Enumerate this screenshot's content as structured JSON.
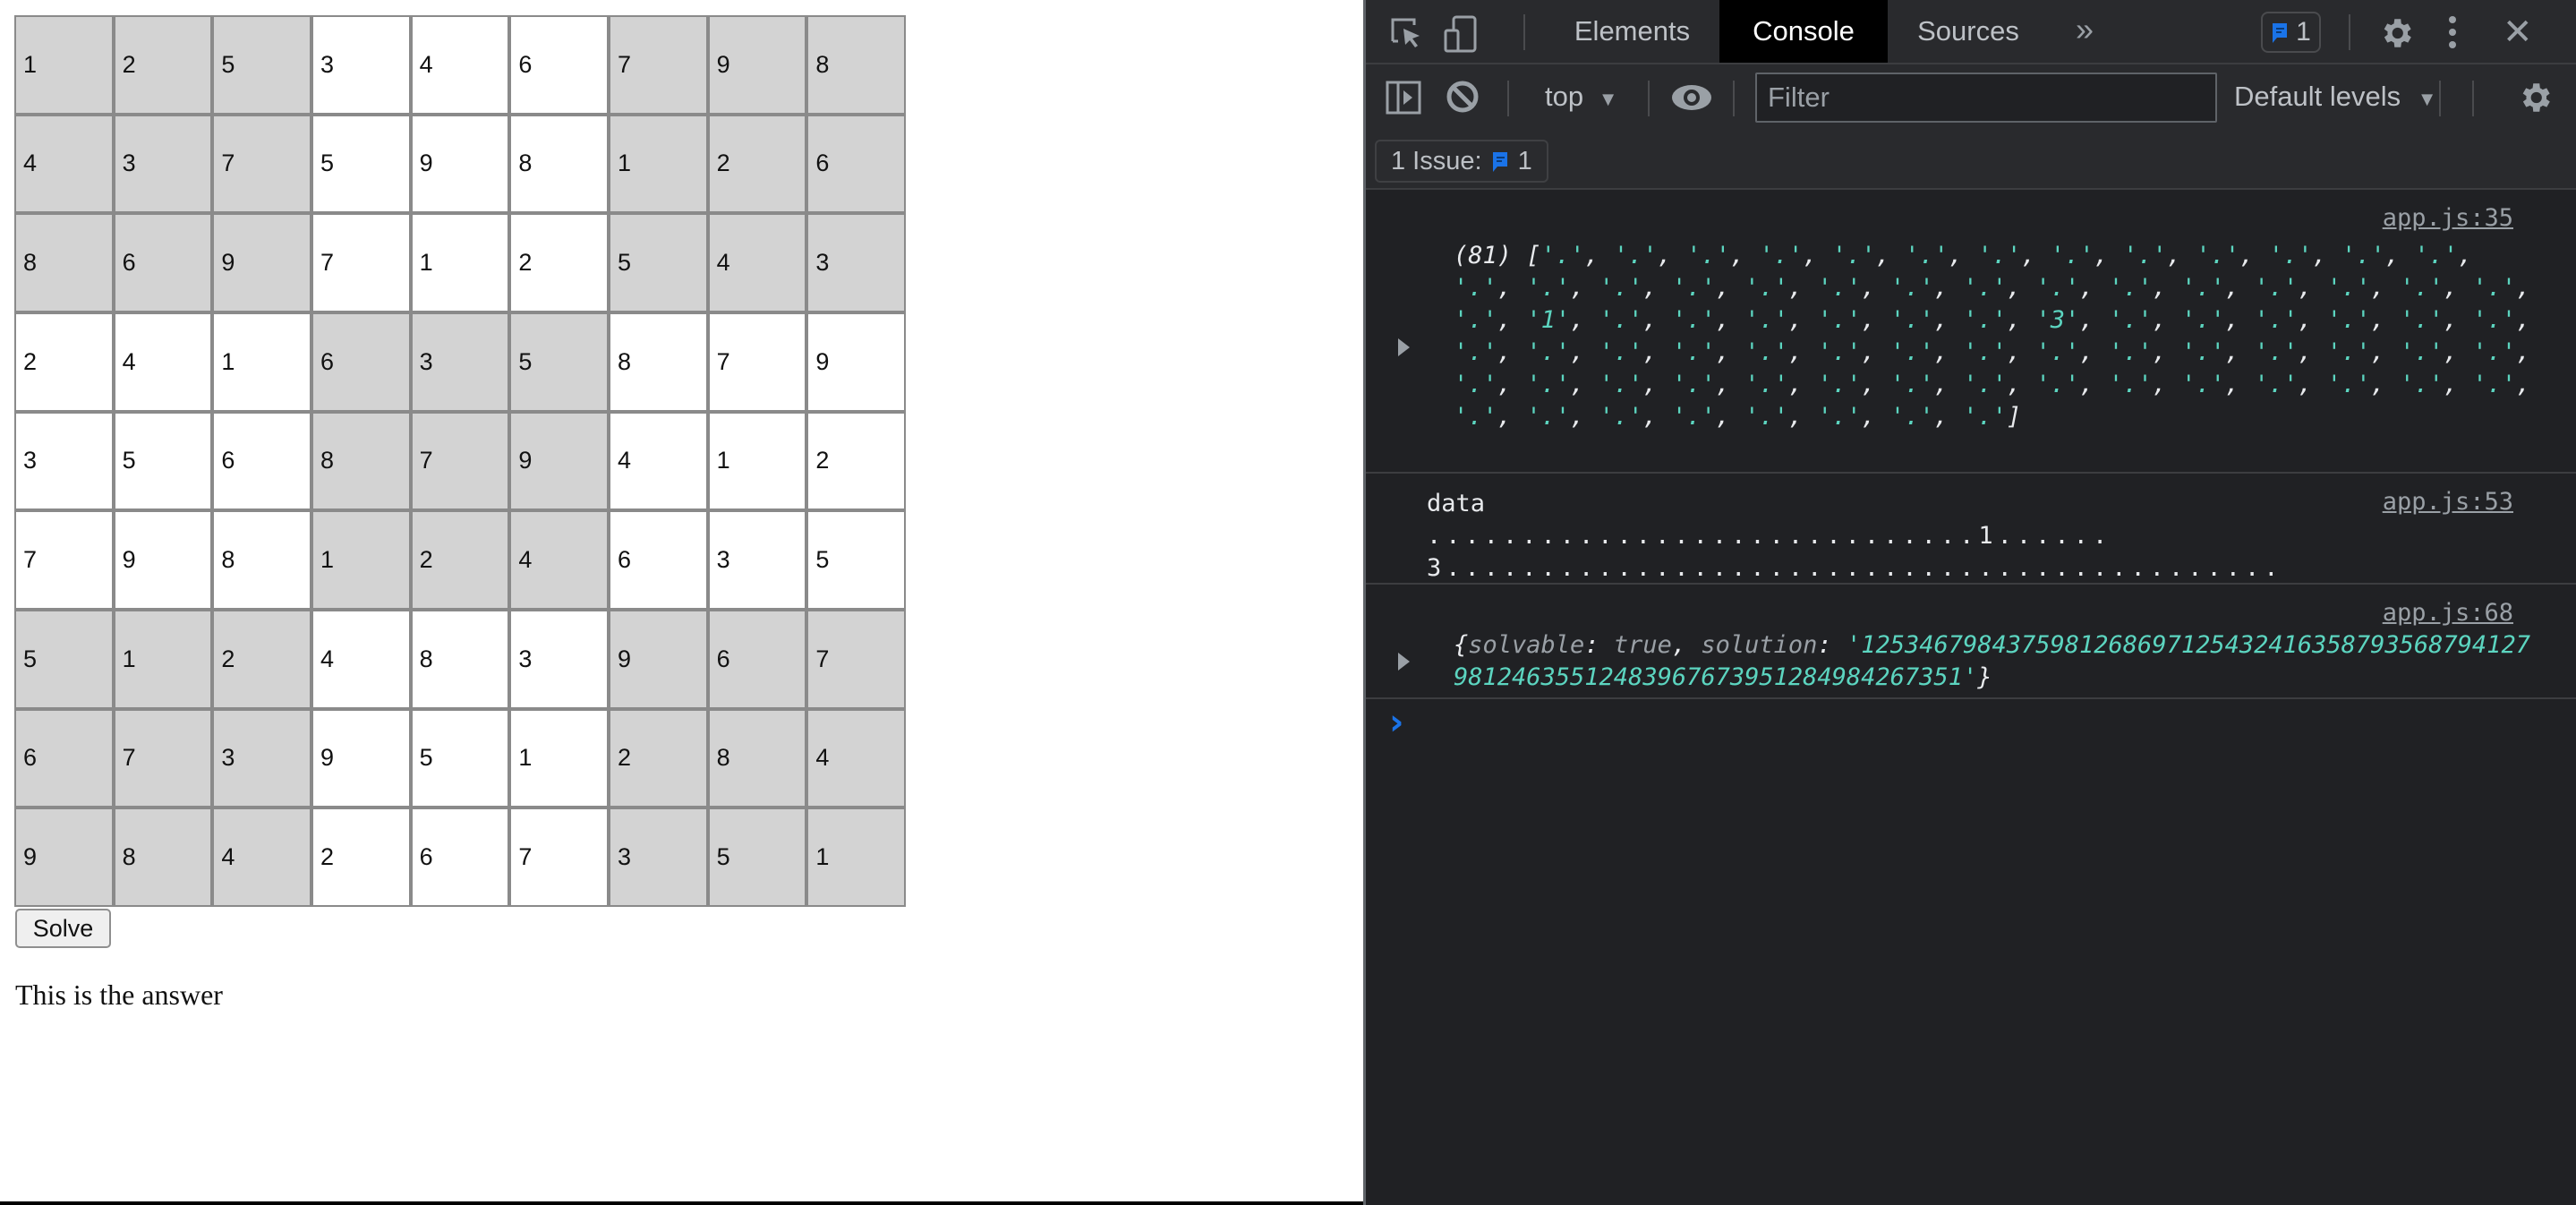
{
  "page": {
    "grid": [
      [
        "1",
        "2",
        "5",
        "3",
        "4",
        "6",
        "7",
        "9",
        "8"
      ],
      [
        "4",
        "3",
        "7",
        "5",
        "9",
        "8",
        "1",
        "2",
        "6"
      ],
      [
        "8",
        "6",
        "9",
        "7",
        "1",
        "2",
        "5",
        "4",
        "3"
      ],
      [
        "2",
        "4",
        "1",
        "6",
        "3",
        "5",
        "8",
        "7",
        "9"
      ],
      [
        "3",
        "5",
        "6",
        "8",
        "7",
        "9",
        "4",
        "1",
        "2"
      ],
      [
        "7",
        "9",
        "8",
        "1",
        "2",
        "4",
        "6",
        "3",
        "5"
      ],
      [
        "5",
        "1",
        "2",
        "4",
        "8",
        "3",
        "9",
        "6",
        "7"
      ],
      [
        "6",
        "7",
        "3",
        "9",
        "5",
        "1",
        "2",
        "8",
        "4"
      ],
      [
        "9",
        "8",
        "4",
        "2",
        "6",
        "7",
        "3",
        "5",
        "1"
      ]
    ],
    "shaded_color": "#d3d3d3",
    "solve_button_label": "Solve",
    "answer_text": "This is the answer"
  },
  "devtools": {
    "tabs": [
      {
        "label": "Elements",
        "active": false
      },
      {
        "label": "Console",
        "active": true
      },
      {
        "label": "Sources",
        "active": false
      }
    ],
    "more_tabs_glyph": "»",
    "issues_badge_count": "1",
    "close_glyph": "✕",
    "toolbar": {
      "context": "top",
      "filter_placeholder": "Filter",
      "filter_value": "",
      "levels": "Default levels"
    },
    "issues_row": {
      "label": "1 Issue:",
      "count": "1"
    },
    "accent_color": "#1a73e8",
    "string_color": "#5cd5c0",
    "messages": [
      {
        "source": "app.js:35",
        "type": "array",
        "length_label": "(81)",
        "items": [
          ".",
          ".",
          ".",
          ".",
          ".",
          ".",
          ".",
          ".",
          ".",
          ".",
          ".",
          ".",
          ".",
          ".",
          ".",
          ".",
          ".",
          ".",
          ".",
          ".",
          ".",
          ".",
          ".",
          ".",
          ".",
          ".",
          ".",
          ".",
          ".",
          "1",
          ".",
          ".",
          ".",
          ".",
          ".",
          ".",
          "3",
          ".",
          ".",
          ".",
          ".",
          ".",
          ".",
          ".",
          ".",
          ".",
          ".",
          ".",
          ".",
          ".",
          ".",
          ".",
          ".",
          ".",
          ".",
          ".",
          ".",
          ".",
          ".",
          ".",
          ".",
          ".",
          ".",
          ".",
          ".",
          ".",
          ".",
          ".",
          ".",
          ".",
          ".",
          ".",
          ".",
          ".",
          ".",
          ".",
          ".",
          ".",
          ".",
          ".",
          "."
        ]
      },
      {
        "source": "app.js:53",
        "type": "text",
        "label": "data",
        "value": ".............................1......3............................................"
      },
      {
        "source": "app.js:68",
        "type": "object",
        "solvable_key": "solvable",
        "solvable_value": "true",
        "solution_key": "solution",
        "solution_value": "125346798437598126869712543241635879356879412798124635512483967673951284984267351"
      }
    ],
    "prompt_glyph": "›"
  }
}
